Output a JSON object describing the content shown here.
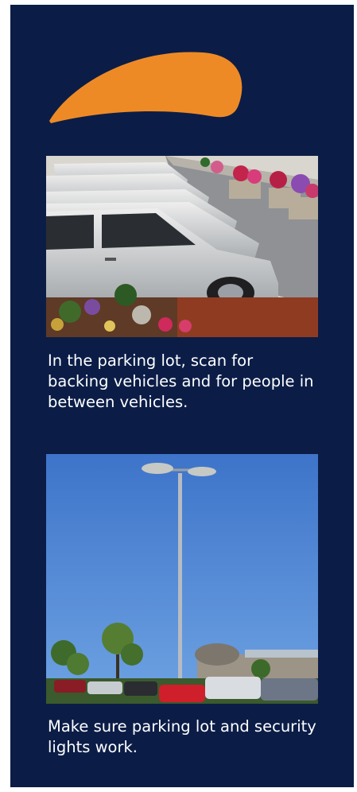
{
  "brand": {
    "accent": "#ee8a25",
    "background": "#0b1d47",
    "logo_icon": "swoosh-icon"
  },
  "tips": [
    {
      "caption": "In the parking lot, scan for backing vehicles and for people in between vehicles."
    },
    {
      "caption": "Make sure parking lot and security lights work."
    }
  ]
}
